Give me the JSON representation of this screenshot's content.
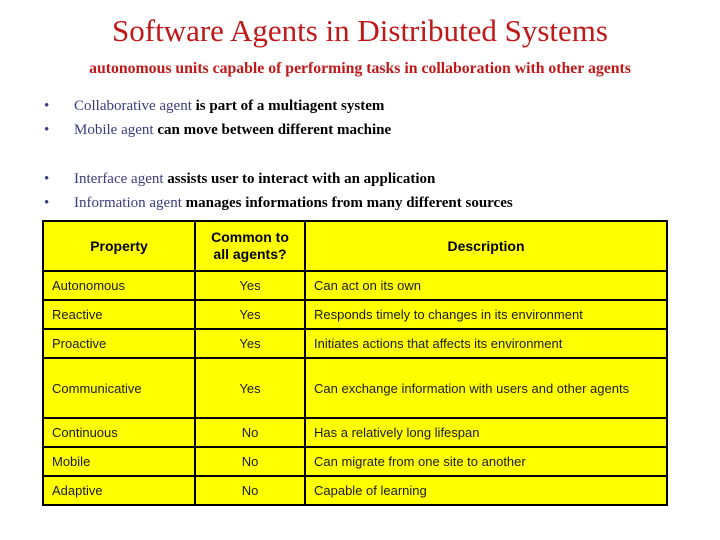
{
  "slide": {
    "title": "Software Agents in Distributed Systems",
    "subtitle": "autonomous units capable of performing tasks in collaboration with other agents",
    "bullet_marker": "•",
    "colors": {
      "title_red": "#c01818",
      "lead_blue": "#3b3b80",
      "table_fill": "#ffff00",
      "table_border": "#000000",
      "body_text": "#1a1a1a"
    }
  },
  "bullet_groups": [
    {
      "items": [
        {
          "lead": "Collaborative agent",
          "rest": " is part of a multiagent system"
        },
        {
          "lead": "Mobile agent",
          "rest": " can move between different machine"
        }
      ]
    },
    {
      "items": [
        {
          "lead": "Interface agent",
          "rest": " assists user to interact with an application"
        },
        {
          "lead": "Information agent",
          "rest": " manages informations from many different sources"
        }
      ]
    }
  ],
  "table": {
    "headers": [
      "Property",
      "Common to\nall agents?",
      "Description"
    ],
    "header_property": "Property",
    "header_common_line1": "Common to",
    "header_common_line2": "all agents?",
    "header_description": "Description",
    "rows": [
      {
        "property": "Autonomous",
        "common": "Yes",
        "description": "Can act on its own"
      },
      {
        "property": "Reactive",
        "common": "Yes",
        "description": "Responds timely to changes in its environment"
      },
      {
        "property": "Proactive",
        "common": "Yes",
        "description": "Initiates actions that affects its environment"
      },
      {
        "property": "Communicative",
        "common": "Yes",
        "description": "Can exchange information with users and other agents"
      },
      {
        "property": "Continuous",
        "common": "No",
        "description": "Has a relatively long lifespan"
      },
      {
        "property": "Mobile",
        "common": "No",
        "description": "Can migrate from one site to another"
      },
      {
        "property": "Adaptive",
        "common": "No",
        "description": "Capable of learning"
      }
    ]
  }
}
